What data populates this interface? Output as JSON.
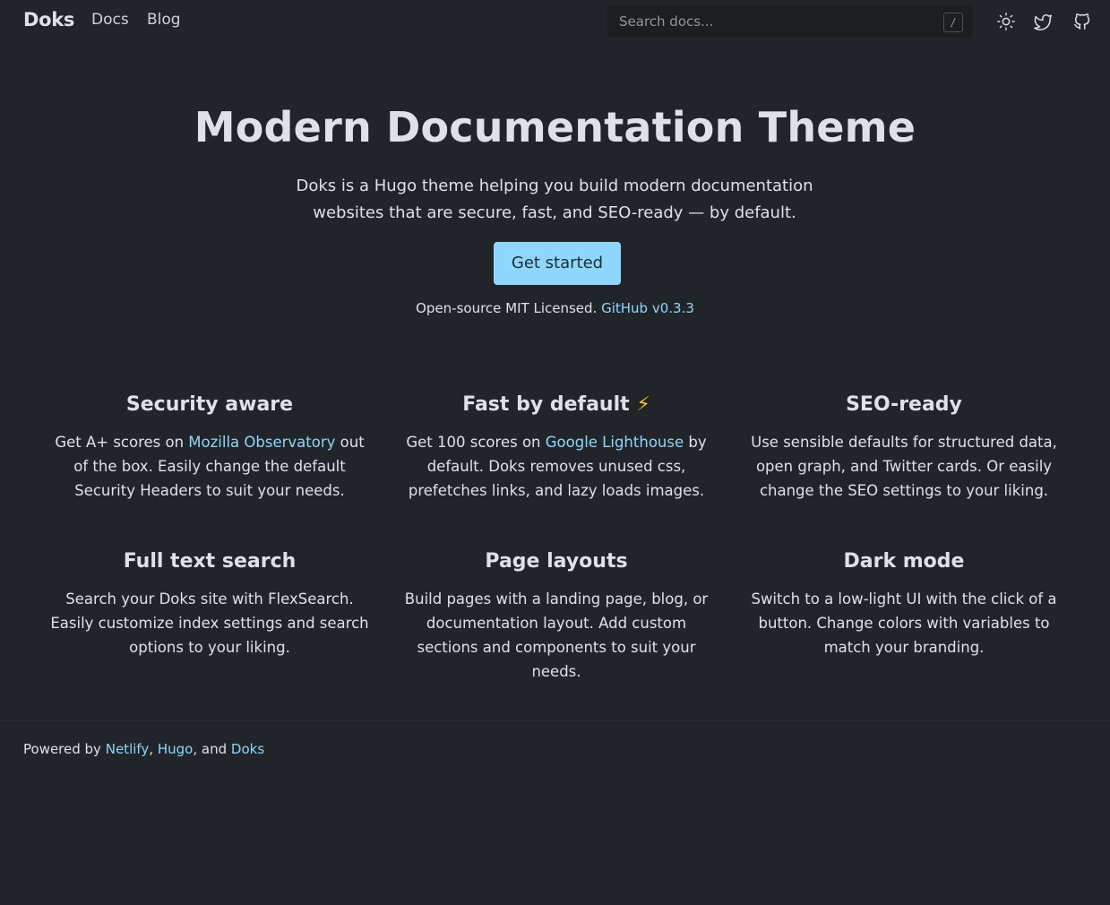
{
  "nav": {
    "brand": "Doks",
    "links": [
      "Docs",
      "Blog"
    ],
    "search_placeholder": "Search docs...",
    "search_shortcut": "/",
    "icons": [
      "sun-icon",
      "twitter-icon",
      "github-icon"
    ]
  },
  "hero": {
    "title": "Modern Documentation Theme",
    "lead_line1": "Doks is a Hugo theme helping you build modern documentation",
    "lead_line2": "websites that are secure, fast, and SEO-ready — by default.",
    "cta": "Get started",
    "license_text": "Open-source MIT Licensed.",
    "license_link": "GitHub v0.3.3"
  },
  "features": [
    {
      "title": "Security aware",
      "pre": "Get A+ scores on ",
      "link": "Mozilla Observatory",
      "post": " out of the box. Easily change the default Security Headers to suit your needs."
    },
    {
      "title": "Fast by default",
      "title_suffix": "⚡",
      "pre": "Get 100 scores on ",
      "link": "Google Lighthouse",
      "post": " by default. Doks removes unused css, prefetches links, and lazy loads images."
    },
    {
      "title": "SEO-ready",
      "text": "Use sensible defaults for structured data, open graph, and Twitter cards. Or easily change the SEO settings to your liking."
    },
    {
      "title": "Full text search",
      "text": "Search your Doks site with FlexSearch. Easily customize index settings and search options to your liking."
    },
    {
      "title": "Page layouts",
      "text": "Build pages with a landing page, blog, or documentation layout. Add custom sections and components to suit your needs."
    },
    {
      "title": "Dark mode",
      "text": "Switch to a low-light UI with the click of a button. Change colors with variables to match your branding."
    }
  ],
  "footer": {
    "prefix": "Powered by",
    "links": [
      "Netlify",
      "Hugo",
      "Doks"
    ],
    "sep1": ",",
    "sep2": ", and"
  },
  "colors": {
    "background": "#212529",
    "accent": "#8ed6fb",
    "text": "#dee2e6"
  }
}
